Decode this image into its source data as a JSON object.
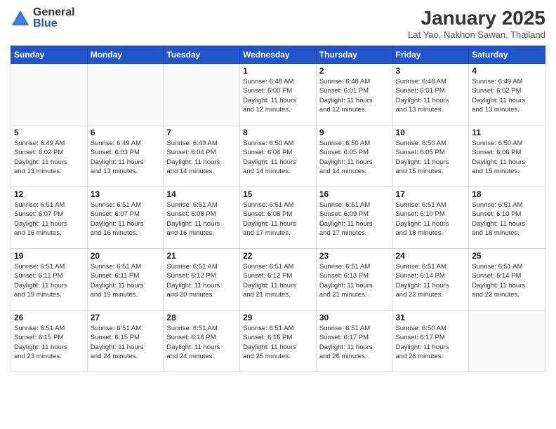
{
  "logo": {
    "general": "General",
    "blue": "Blue"
  },
  "title": "January 2025",
  "subtitle": "Lat Yao, Nakhon Sawan, Thailand",
  "headers": [
    "Sunday",
    "Monday",
    "Tuesday",
    "Wednesday",
    "Thursday",
    "Friday",
    "Saturday"
  ],
  "weeks": [
    [
      {
        "day": "",
        "info": ""
      },
      {
        "day": "",
        "info": ""
      },
      {
        "day": "",
        "info": ""
      },
      {
        "day": "1",
        "info": "Sunrise: 6:48 AM\nSunset: 6:00 PM\nDaylight: 11 hours\nand 12 minutes."
      },
      {
        "day": "2",
        "info": "Sunrise: 6:48 AM\nSunset: 6:01 PM\nDaylight: 11 hours\nand 12 minutes."
      },
      {
        "day": "3",
        "info": "Sunrise: 6:48 AM\nSunset: 6:01 PM\nDaylight: 11 hours\nand 13 minutes."
      },
      {
        "day": "4",
        "info": "Sunrise: 6:49 AM\nSunset: 6:02 PM\nDaylight: 11 hours\nand 13 minutes."
      }
    ],
    [
      {
        "day": "5",
        "info": "Sunrise: 6:49 AM\nSunset: 6:02 PM\nDaylight: 11 hours\nand 13 minutes."
      },
      {
        "day": "6",
        "info": "Sunrise: 6:49 AM\nSunset: 6:03 PM\nDaylight: 11 hours\nand 13 minutes."
      },
      {
        "day": "7",
        "info": "Sunrise: 6:49 AM\nSunset: 6:04 PM\nDaylight: 11 hours\nand 14 minutes."
      },
      {
        "day": "8",
        "info": "Sunrise: 6:50 AM\nSunset: 6:04 PM\nDaylight: 11 hours\nand 14 minutes."
      },
      {
        "day": "9",
        "info": "Sunrise: 6:50 AM\nSunset: 6:05 PM\nDaylight: 11 hours\nand 14 minutes."
      },
      {
        "day": "10",
        "info": "Sunrise: 6:50 AM\nSunset: 6:05 PM\nDaylight: 11 hours\nand 15 minutes."
      },
      {
        "day": "11",
        "info": "Sunrise: 6:50 AM\nSunset: 6:06 PM\nDaylight: 11 hours\nand 15 minutes."
      }
    ],
    [
      {
        "day": "12",
        "info": "Sunrise: 6:51 AM\nSunset: 6:07 PM\nDaylight: 11 hours\nand 16 minutes."
      },
      {
        "day": "13",
        "info": "Sunrise: 6:51 AM\nSunset: 6:07 PM\nDaylight: 11 hours\nand 16 minutes."
      },
      {
        "day": "14",
        "info": "Sunrise: 6:51 AM\nSunset: 6:08 PM\nDaylight: 11 hours\nand 16 minutes."
      },
      {
        "day": "15",
        "info": "Sunrise: 6:51 AM\nSunset: 6:08 PM\nDaylight: 11 hours\nand 17 minutes."
      },
      {
        "day": "16",
        "info": "Sunrise: 6:51 AM\nSunset: 6:09 PM\nDaylight: 11 hours\nand 17 minutes."
      },
      {
        "day": "17",
        "info": "Sunrise: 6:51 AM\nSunset: 6:10 PM\nDaylight: 11 hours\nand 18 minutes."
      },
      {
        "day": "18",
        "info": "Sunrise: 6:51 AM\nSunset: 6:10 PM\nDaylight: 11 hours\nand 18 minutes."
      }
    ],
    [
      {
        "day": "19",
        "info": "Sunrise: 6:51 AM\nSunset: 6:11 PM\nDaylight: 11 hours\nand 19 minutes."
      },
      {
        "day": "20",
        "info": "Sunrise: 6:51 AM\nSunset: 6:11 PM\nDaylight: 11 hours\nand 19 minutes."
      },
      {
        "day": "21",
        "info": "Sunrise: 6:51 AM\nSunset: 6:12 PM\nDaylight: 11 hours\nand 20 minutes."
      },
      {
        "day": "22",
        "info": "Sunrise: 6:51 AM\nSunset: 6:12 PM\nDaylight: 11 hours\nand 21 minutes."
      },
      {
        "day": "23",
        "info": "Sunrise: 6:51 AM\nSunset: 6:13 PM\nDaylight: 11 hours\nand 21 minutes."
      },
      {
        "day": "24",
        "info": "Sunrise: 6:51 AM\nSunset: 6:14 PM\nDaylight: 11 hours\nand 22 minutes."
      },
      {
        "day": "25",
        "info": "Sunrise: 6:51 AM\nSunset: 6:14 PM\nDaylight: 11 hours\nand 22 minutes."
      }
    ],
    [
      {
        "day": "26",
        "info": "Sunrise: 6:51 AM\nSunset: 6:15 PM\nDaylight: 11 hours\nand 23 minutes."
      },
      {
        "day": "27",
        "info": "Sunrise: 6:51 AM\nSunset: 6:15 PM\nDaylight: 11 hours\nand 24 minutes."
      },
      {
        "day": "28",
        "info": "Sunrise: 6:51 AM\nSunset: 6:16 PM\nDaylight: 11 hours\nand 24 minutes."
      },
      {
        "day": "29",
        "info": "Sunrise: 6:51 AM\nSunset: 6:16 PM\nDaylight: 11 hours\nand 25 minutes."
      },
      {
        "day": "30",
        "info": "Sunrise: 6:51 AM\nSunset: 6:17 PM\nDaylight: 11 hours\nand 26 minutes."
      },
      {
        "day": "31",
        "info": "Sunrise: 6:50 AM\nSunset: 6:17 PM\nDaylight: 11 hours\nand 26 minutes."
      },
      {
        "day": "",
        "info": ""
      }
    ]
  ]
}
